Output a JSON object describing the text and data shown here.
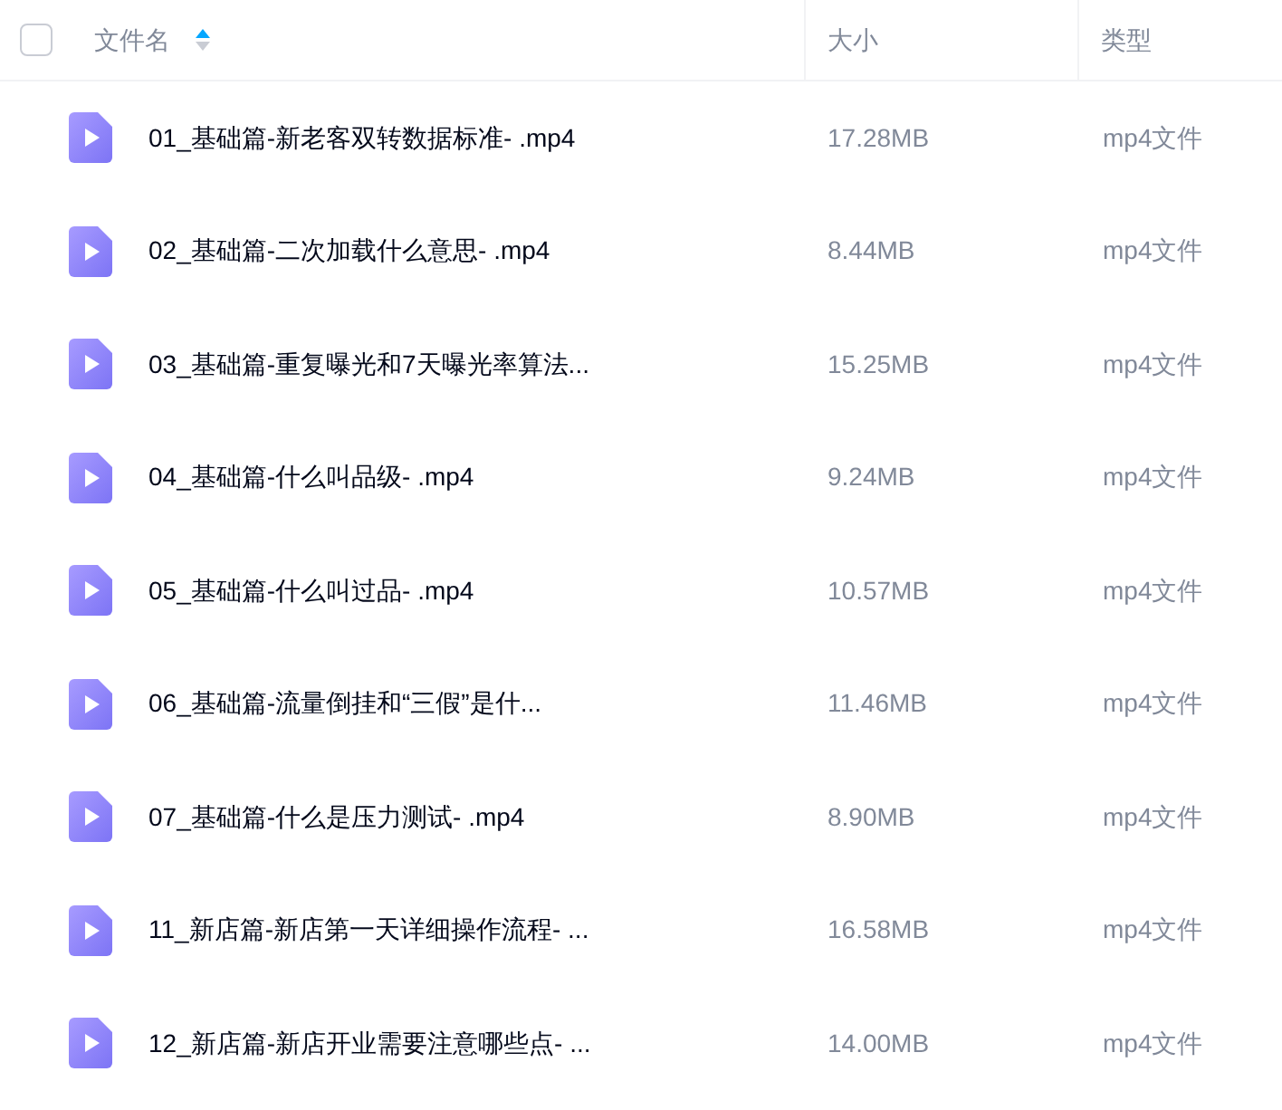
{
  "header": {
    "select_all": {
      "checked": false
    },
    "columns": [
      {
        "label": "文件名",
        "sort_ascending": true
      },
      {
        "label": "大小"
      },
      {
        "label": "类型"
      }
    ]
  },
  "files": [
    {
      "name": "01_基础篇-新老客双转数据标准- .mp4",
      "size": "17.28MB",
      "type": "mp4文件"
    },
    {
      "name": "02_基础篇-二次加载什么意思- .mp4",
      "size": "8.44MB",
      "type": "mp4文件"
    },
    {
      "name": "03_基础篇-重复曝光和7天曝光率算法...",
      "size": "15.25MB",
      "type": "mp4文件"
    },
    {
      "name": "04_基础篇-什么叫品级- .mp4",
      "size": "9.24MB",
      "type": "mp4文件"
    },
    {
      "name": "05_基础篇-什么叫过品- .mp4",
      "size": "10.57MB",
      "type": "mp4文件"
    },
    {
      "name": "06_基础篇-流量倒挂和“三假”是什...",
      "size": "11.46MB",
      "type": "mp4文件"
    },
    {
      "name": "07_基础篇-什么是压力测试- .mp4",
      "size": "8.90MB",
      "type": "mp4文件"
    },
    {
      "name": "11_新店篇-新店第一天详细操作流程- ...",
      "size": "16.58MB",
      "type": "mp4文件"
    },
    {
      "name": "12_新店篇-新店开业需要注意哪些点- ...",
      "size": "14.00MB",
      "type": "mp4文件"
    }
  ]
}
